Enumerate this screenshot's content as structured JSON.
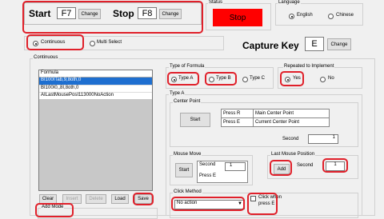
{
  "hotkeys": {
    "start_label": "Start",
    "start_key": "F7",
    "stop_label": "Stop",
    "stop_key": "F8",
    "change_label": "Change"
  },
  "status": {
    "title": "Status",
    "value": "Stop",
    "color": "#ff0000"
  },
  "language": {
    "title": "Language",
    "english": "English",
    "chinese": "Chinese",
    "selected": "English"
  },
  "mode": {
    "continuous": "Continuous",
    "multi_select": "Multi Select",
    "selected": "Continuous"
  },
  "capture": {
    "label": "Capture Key",
    "key": "E",
    "change_label": "Change"
  },
  "continuous_group": {
    "title": "Continuous"
  },
  "list": {
    "header": "Formula",
    "items": [
      "BI100ITab,9,8oth,0",
      "BI100I0,,8I,8oth,0",
      "AILastMousePosI113000NoAction"
    ],
    "buttons": {
      "clear": "Clear",
      "insert": "Insert",
      "delete": "Delete",
      "load": "Load",
      "save": "Save"
    }
  },
  "formula_type": {
    "title": "Type of Formula",
    "type_a": "Type A",
    "type_b": "Type B",
    "type_c": "Type C",
    "selected": "Type A"
  },
  "repeated": {
    "title": "Repeated to Implement",
    "yes": "Yes",
    "no": "No",
    "selected": "Yes"
  },
  "type_a": {
    "title": "Type A"
  },
  "center_point": {
    "title": "Center Point",
    "start_label": "Start",
    "rows": [
      [
        "Press R",
        "Main Center Point"
      ],
      [
        "Press E",
        "Current Center Point"
      ]
    ],
    "second_label": "Second",
    "second_value": "1"
  },
  "mouse_move": {
    "title": "Mouse Move",
    "start_label": "Start",
    "second_label": "Second",
    "second_value": "1",
    "press_label": "Press E"
  },
  "last_pos": {
    "title": "Last Mouse Position",
    "add_label": "Add",
    "second_label": "Second",
    "second_value": "1"
  },
  "click_method": {
    "title": "Click Method",
    "value": "No action",
    "check_label_1": "Click when",
    "check_label_2": "press E"
  },
  "add_mode": {
    "title": "Add Mode"
  }
}
